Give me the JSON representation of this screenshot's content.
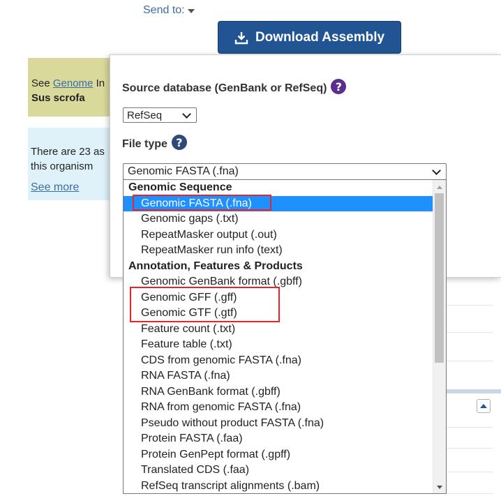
{
  "header": {
    "send_to_label": "Send to:",
    "download_button_label": "Download Assembly"
  },
  "info_box_genome": {
    "prefix": "See ",
    "link": "Genome",
    "suffix": " In",
    "organism": "Sus scrofa"
  },
  "info_box_assemblies": {
    "line1": "There are 23 as",
    "line2": "this organism",
    "see_more": "See more"
  },
  "popup": {
    "source_label": "Source database (GenBank or RefSeq)",
    "source_value": "RefSeq",
    "file_type_label": "File type",
    "file_type_value": "Genomic FASTA (.fna)",
    "help_icon_glyph": "?"
  },
  "dropdown": {
    "options": [
      {
        "label": "Genomic Sequence",
        "group": true
      },
      {
        "label": "Genomic FASTA (.fna)",
        "selected": true
      },
      {
        "label": "Genomic gaps (.txt)"
      },
      {
        "label": "RepeatMasker output (.out)"
      },
      {
        "label": "RepeatMasker run info (text)"
      },
      {
        "label": "Annotation, Features & Products",
        "group": true
      },
      {
        "label": "Genomic GenBank format (.gbff)"
      },
      {
        "label": "Genomic GFF (.gff)"
      },
      {
        "label": "Genomic GTF (.gtf)"
      },
      {
        "label": "Feature count (.txt)"
      },
      {
        "label": "Feature table (.txt)"
      },
      {
        "label": "CDS from genomic FASTA (.fna)"
      },
      {
        "label": "RNA FASTA (.fna)"
      },
      {
        "label": "RNA GenBank format (.gbff)"
      },
      {
        "label": "RNA from genomic FASTA (.fna)"
      },
      {
        "label": "Pseudo without product FASTA (.fna)"
      },
      {
        "label": "Protein FASTA (.faa)"
      },
      {
        "label": "Protein GenPept format (.gpff)"
      },
      {
        "label": "Translated CDS (.faa)"
      },
      {
        "label": "RefSeq transcript alignments (.bam)"
      }
    ]
  },
  "colors": {
    "button_bg": "#205493",
    "selected_bg": "#1e90ff",
    "highlight_border": "#e8242a"
  }
}
